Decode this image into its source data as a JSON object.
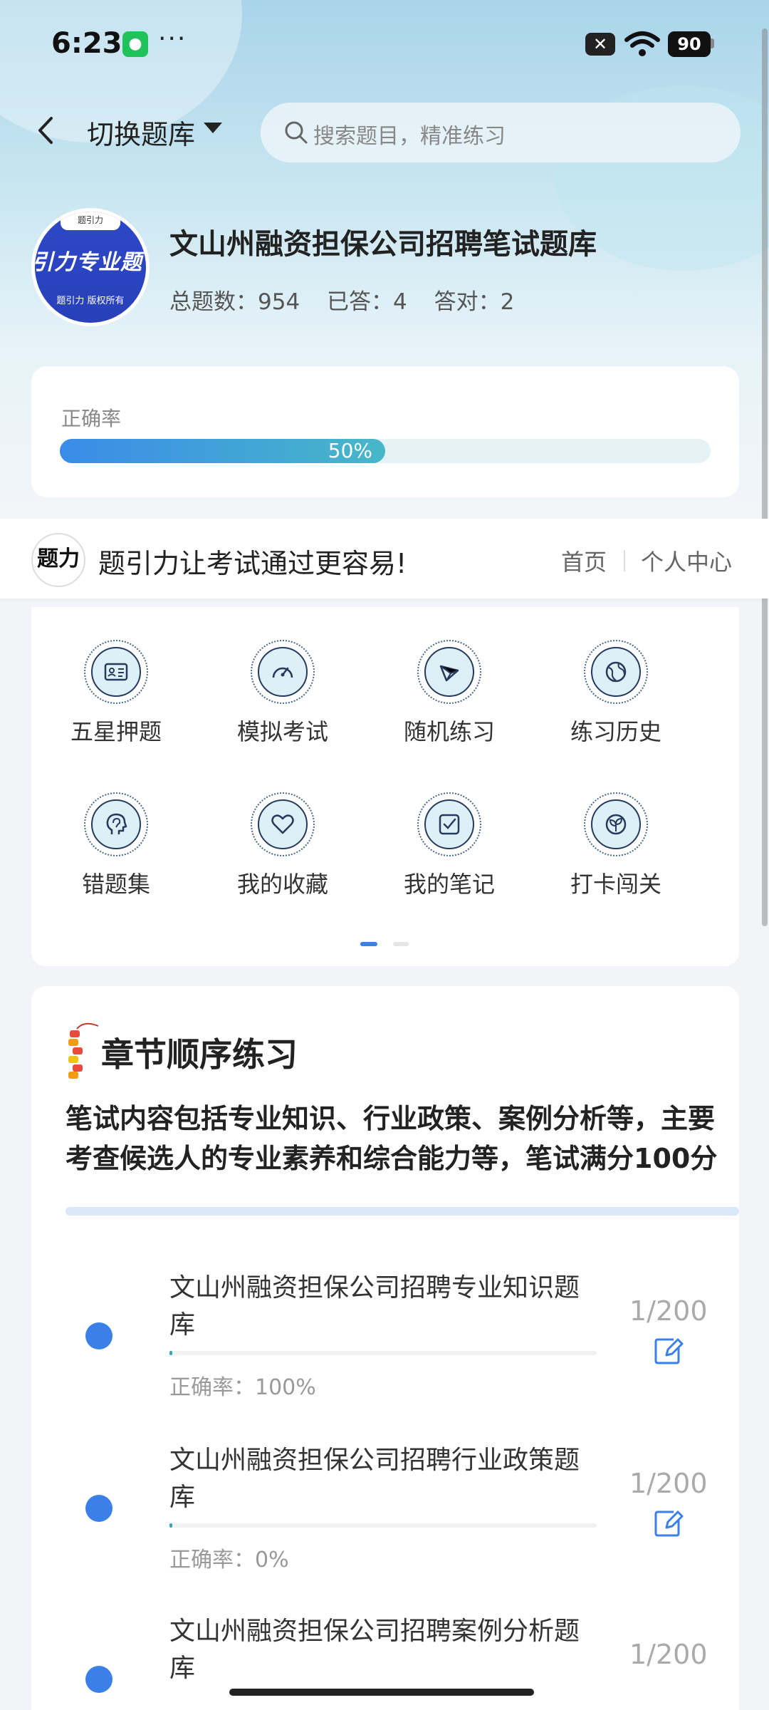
{
  "status_bar": {
    "time": "6:23",
    "dots": "···",
    "battery": "90"
  },
  "nav": {
    "switch_label": "切换题库",
    "search_placeholder": "搜索题目，精准练习"
  },
  "bank": {
    "logo_main": "引力专业题",
    "logo_sub": "题引力 版权所有",
    "logo_top": "题引力",
    "title": "文山州融资担保公司招聘笔试题库",
    "total": "总题数：954",
    "answered": "已答：4",
    "correct": "答对：2"
  },
  "accuracy": {
    "label": "正确率",
    "value_text": "50%",
    "fraction": 0.5
  },
  "brand": {
    "logo_text": "题力",
    "slogan": "题引力让考试通过更容易!",
    "home": "首页",
    "personal_center": "个人中心"
  },
  "grid": {
    "items": [
      {
        "label": "五星押题",
        "icon": "id-card-icon"
      },
      {
        "label": "模拟考试",
        "icon": "gauge-icon"
      },
      {
        "label": "随机练习",
        "icon": "shuffle-icon"
      },
      {
        "label": "练习历史",
        "icon": "globe-icon"
      },
      {
        "label": "错题集",
        "icon": "brain-head-icon"
      },
      {
        "label": "我的收藏",
        "icon": "heart-icon"
      },
      {
        "label": "我的笔记",
        "icon": "note-check-icon"
      },
      {
        "label": "打卡闯关",
        "icon": "sprout-icon"
      }
    ]
  },
  "chapter": {
    "title": "章节顺序练习",
    "description": "笔试内容包括专业知识、行业政策、案例分析等，主要考查候选人的专业素养和综合能力等，笔试满分100分",
    "items": [
      {
        "name": "文山州融资担保公司招聘专业知识题库",
        "accuracy": "正确率：100%",
        "count": "1/200",
        "progress": 0.005
      },
      {
        "name": "文山州融资担保公司招聘行业政策题库",
        "accuracy": "正确率：0%",
        "count": "1/200",
        "progress": 0.005
      },
      {
        "name": "文山州融资担保公司招聘案例分析题库",
        "accuracy": "",
        "count": "1/200",
        "progress": 0.005
      }
    ]
  },
  "colors": {
    "accent": "#3b7fe8",
    "teal": "#48b7c8"
  }
}
